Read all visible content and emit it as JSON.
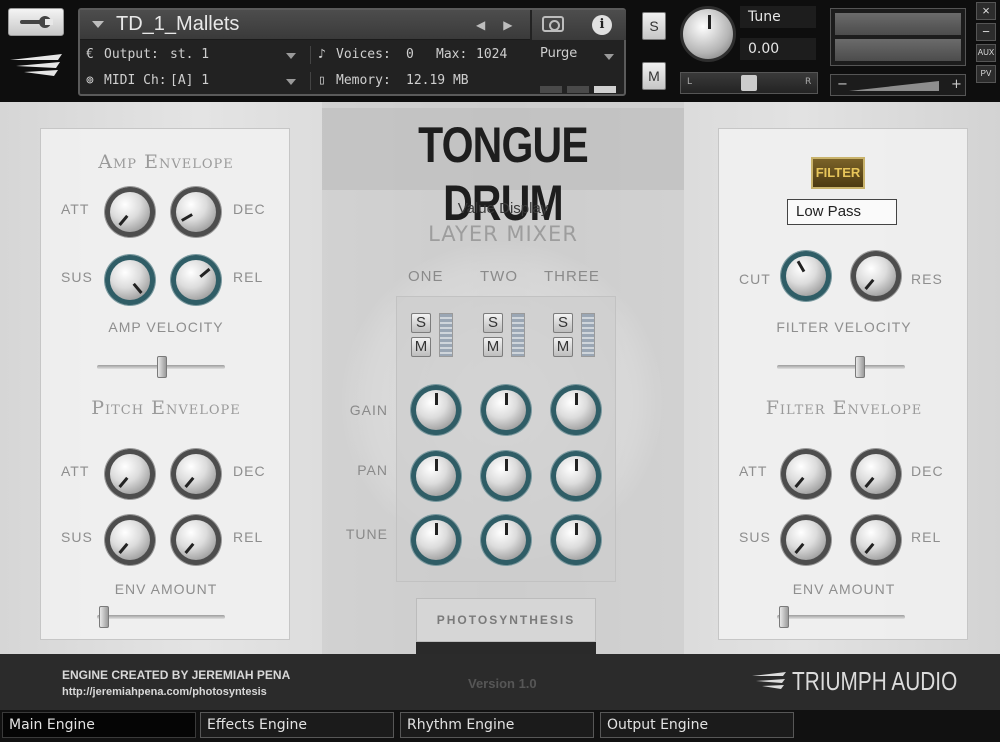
{
  "header": {
    "instrument_name": "TD_1_Mallets",
    "output_label": "Output:",
    "output_value": "st. 1",
    "voices_label": "Voices:",
    "voices_value": "0",
    "max_label": "Max:",
    "max_value": "1024",
    "midi_label": "MIDI Ch:",
    "midi_value": "[A]  1",
    "memory_label": "Memory:",
    "memory_value": "12.19 MB",
    "purge_label": "Purge",
    "solo_label": "S",
    "mute_label": "M",
    "tune_label": "Tune",
    "tune_value": "0.00",
    "pan_left": "L",
    "pan_right": "R",
    "vol_minus": "−",
    "vol_plus": "+",
    "aux_label": "AUX",
    "pv_label": "PV",
    "close_label": "×",
    "min_label": "−"
  },
  "amp_envelope": {
    "title": "Amp Envelope",
    "att": "ATT",
    "dec": "DEC",
    "sus": "SUS",
    "rel": "REL",
    "velocity_title": "AMP VELOCITY"
  },
  "pitch_envelope": {
    "title": "Pitch Envelope",
    "att": "ATT",
    "dec": "DEC",
    "sus": "SUS",
    "rel": "REL",
    "env_amount": "ENV AMOUNT"
  },
  "center": {
    "title": "TONGUE DRUM",
    "value_display": "Value Display",
    "layer_mixer": "LAYER MIXER",
    "columns": [
      "ONE",
      "TWO",
      "THREE"
    ],
    "solo": "S",
    "mute": "M",
    "rows": [
      "GAIN",
      "PAN",
      "TUNE"
    ],
    "photo_tab": "PHOTOSYNTHESIS"
  },
  "filter": {
    "button": "FILTER",
    "type": "Low Pass",
    "cut": "CUT",
    "res": "RES",
    "velocity_title": "FILTER VELOCITY"
  },
  "filter_envelope": {
    "title": "Filter Envelope",
    "att": "ATT",
    "dec": "DEC",
    "sus": "SUS",
    "rel": "REL",
    "env_amount": "ENV AMOUNT"
  },
  "footer": {
    "credit": "ENGINE CREATED BY JEREMIAH PENA",
    "url": "http://jeremiahpena.com/photosyntesis",
    "version": "Version 1.0",
    "brand": "TRIUMPH AUDIO"
  },
  "tabs": [
    {
      "label": "Main Engine",
      "active": true
    },
    {
      "label": "Effects Engine",
      "active": false
    },
    {
      "label": "Rhythm Engine",
      "active": false
    },
    {
      "label": "Output Engine",
      "active": false
    }
  ],
  "colors": {
    "teal_ring": "#2f5d66",
    "filter_gold": "#e7c55a",
    "header_bg": "#0e0e0e"
  }
}
